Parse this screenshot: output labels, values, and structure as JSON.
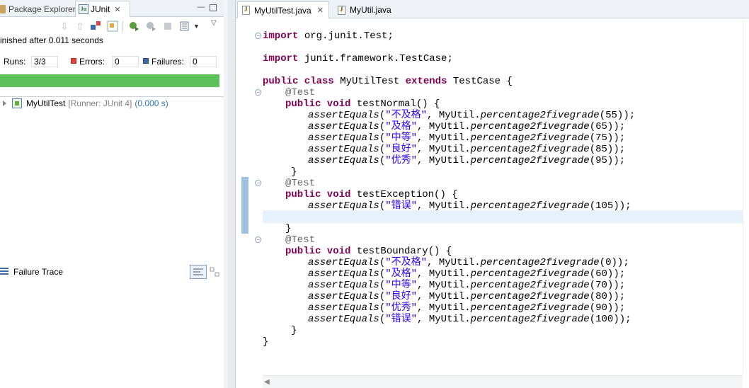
{
  "junit_view": {
    "tabs": {
      "package_explorer": "Package Explorer",
      "junit": "JUnit",
      "close": "✕"
    },
    "status": "inished after 0.011 seconds",
    "runs_label": "Runs:",
    "runs_value": "3/3",
    "errors_label": "Errors:",
    "errors_value": "0",
    "failures_label": "Failures:",
    "failures_value": "0",
    "progress_fraction": 1.0,
    "progress_color": "#5fc15a",
    "tree": {
      "test_class": "MyUtilTest",
      "runner": "[Runner: JUnit 4]",
      "duration": "(0.000 s)"
    },
    "failure_trace_title": "Failure Trace"
  },
  "editor": {
    "tabs": {
      "active": "MyUtilTest.java",
      "close": "✕",
      "other": "MyUtil.java"
    },
    "current_line_color": "#e8f2fe",
    "code": {
      "l1_kw": "import",
      "l1_rest": " org.junit.Test;",
      "l2_kw": "import",
      "l2_rest": " junit.framework.TestCase;",
      "l3_kw1": "public class",
      "l3_name": " MyUtilTest ",
      "l3_kw2": "extends",
      "l3_rest": " TestCase {",
      "annotation": "@Test",
      "m1_kw": "public void",
      "m1_rest": " testNormal() {",
      "m2_kw": "public void",
      "m2_rest": " testException() {",
      "m3_kw": "public void",
      "m3_rest": " testBoundary() {",
      "assert_fn": "assertEquals",
      "util_fn": "percentage2fivegrade",
      "util_prefix": "MyUtil.",
      "normal_asserts": [
        {
          "str": "\"不及格\"",
          "arg": "55"
        },
        {
          "str": "\"及格\"",
          "arg": "65"
        },
        {
          "str": "\"中等\"",
          "arg": "75"
        },
        {
          "str": "\"良好\"",
          "arg": "85"
        },
        {
          "str": "\"优秀\"",
          "arg": "95"
        }
      ],
      "exception_asserts": [
        {
          "str": "\"错误\"",
          "arg": "105"
        }
      ],
      "boundary_asserts": [
        {
          "str": "\"不及格\"",
          "arg": "0"
        },
        {
          "str": "\"及格\"",
          "arg": "60"
        },
        {
          "str": "\"中等\"",
          "arg": "70"
        },
        {
          "str": "\"良好\"",
          "arg": "80"
        },
        {
          "str": "\"优秀\"",
          "arg": "90"
        },
        {
          "str": "\"错误\"",
          "arg": "100"
        }
      ],
      "close_brace": "}"
    }
  }
}
